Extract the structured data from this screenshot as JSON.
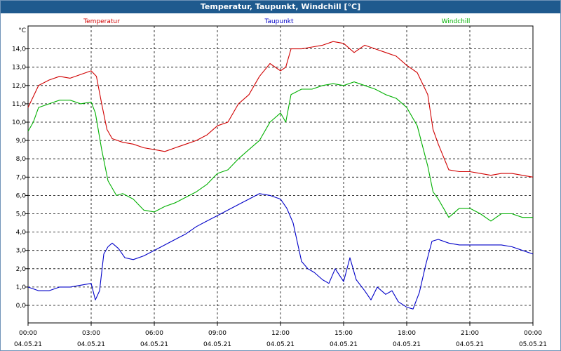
{
  "window": {
    "title": "Temperatur, Taupunkt, Windchill [°C]"
  },
  "chart_data": {
    "type": "line",
    "title": "Temperatur, Taupunkt, Windchill [°C]",
    "yunit": "°C",
    "ylim": [
      -1,
      15
    ],
    "xlim": [
      0,
      24
    ],
    "grid": true,
    "legend_position": "top",
    "y_ticks": [
      "0,0",
      "1,0",
      "2,0",
      "3,0",
      "4,0",
      "5,0",
      "6,0",
      "7,0",
      "8,0",
      "9,0",
      "10,0",
      "11,0",
      "12,0",
      "13,0",
      "14,0"
    ],
    "x_ticks": [
      {
        "time": "00:00",
        "date": "04.05.21"
      },
      {
        "time": "03:00",
        "date": "04.05.21"
      },
      {
        "time": "06:00",
        "date": "04.05.21"
      },
      {
        "time": "09:00",
        "date": "04.05.21"
      },
      {
        "time": "12:00",
        "date": "04.05.21"
      },
      {
        "time": "15:00",
        "date": "04.05.21"
      },
      {
        "time": "18:00",
        "date": "04.05.21"
      },
      {
        "time": "21:00",
        "date": "04.05.21"
      },
      {
        "time": "00:00",
        "date": "05.05.21"
      }
    ],
    "series": [
      {
        "name": "Temperatur",
        "color": "#d00000",
        "x": [
          0,
          0.25,
          0.5,
          1,
          1.5,
          2,
          2.5,
          3,
          3.25,
          3.5,
          3.75,
          4,
          4.5,
          5,
          5.5,
          6,
          6.5,
          7,
          7.5,
          8,
          8.5,
          9,
          9.5,
          10,
          10.5,
          11,
          11.5,
          12,
          12.25,
          12.5,
          13,
          13.5,
          14,
          14.5,
          15,
          15.5,
          16,
          16.5,
          17,
          17.5,
          18,
          18.5,
          19,
          19.25,
          19.5,
          20,
          20.5,
          21,
          21.5,
          22,
          22.5,
          23,
          23.5,
          24
        ],
        "values": [
          10.8,
          11.4,
          12.0,
          12.3,
          12.5,
          12.4,
          12.6,
          12.8,
          12.5,
          11.0,
          9.6,
          9.1,
          8.9,
          8.8,
          8.6,
          8.5,
          8.4,
          8.6,
          8.8,
          9.0,
          9.3,
          9.8,
          10.0,
          11.0,
          11.5,
          12.5,
          13.2,
          12.8,
          13.0,
          14.0,
          14.0,
          14.1,
          14.2,
          14.4,
          14.3,
          13.8,
          14.2,
          14.0,
          13.8,
          13.6,
          13.1,
          12.7,
          11.5,
          9.6,
          8.8,
          7.4,
          7.3,
          7.3,
          7.2,
          7.1,
          7.2,
          7.2,
          7.1,
          7.0
        ]
      },
      {
        "name": "Taupunkt",
        "color": "#0000c8",
        "x": [
          0,
          0.5,
          1,
          1.5,
          2,
          2.5,
          3,
          3.2,
          3.4,
          3.6,
          3.8,
          4,
          4.3,
          4.6,
          5,
          5.5,
          6,
          6.5,
          7,
          7.5,
          8,
          8.5,
          9,
          9.5,
          10,
          10.5,
          11,
          11.5,
          12,
          12.3,
          12.6,
          13,
          13.3,
          13.6,
          14,
          14.3,
          14.6,
          15,
          15.3,
          15.6,
          16,
          16.3,
          16.6,
          17,
          17.3,
          17.6,
          18,
          18.3,
          18.6,
          18.9,
          19.2,
          19.5,
          20,
          20.5,
          21,
          21.5,
          22,
          22.5,
          23,
          23.5,
          24
        ],
        "values": [
          1.0,
          0.8,
          0.8,
          1.0,
          1.0,
          1.1,
          1.2,
          0.3,
          0.8,
          2.8,
          3.2,
          3.4,
          3.1,
          2.6,
          2.5,
          2.7,
          3.0,
          3.3,
          3.6,
          3.9,
          4.3,
          4.6,
          4.9,
          5.2,
          5.5,
          5.8,
          6.1,
          6.0,
          5.8,
          5.3,
          4.5,
          2.4,
          2.0,
          1.8,
          1.4,
          1.2,
          2.0,
          1.3,
          2.6,
          1.4,
          0.8,
          0.3,
          1.0,
          0.6,
          0.8,
          0.2,
          -0.1,
          -0.2,
          0.7,
          2.2,
          3.5,
          3.6,
          3.4,
          3.3,
          3.3,
          3.3,
          3.3,
          3.3,
          3.2,
          3.0,
          2.8
        ]
      },
      {
        "name": "Windchill",
        "color": "#00b000",
        "x": [
          0,
          0.25,
          0.5,
          1,
          1.5,
          2,
          2.5,
          3,
          3.2,
          3.5,
          3.8,
          4.2,
          4.5,
          5,
          5.5,
          6,
          6.5,
          7,
          7.5,
          8,
          8.5,
          9,
          9.5,
          10,
          10.5,
          11,
          11.5,
          12,
          12.25,
          12.5,
          13,
          13.5,
          14,
          14.5,
          15,
          15.5,
          16,
          16.5,
          17,
          17.5,
          18,
          18.5,
          19,
          19.25,
          19.5,
          20,
          20.5,
          21,
          21.5,
          22,
          22.5,
          23,
          23.5,
          24
        ],
        "values": [
          9.5,
          10.0,
          10.8,
          11.0,
          11.2,
          11.2,
          11.0,
          11.1,
          10.5,
          8.5,
          6.8,
          6.0,
          6.1,
          5.8,
          5.2,
          5.1,
          5.4,
          5.6,
          5.9,
          6.2,
          6.6,
          7.2,
          7.4,
          8.0,
          8.5,
          9.0,
          10.0,
          10.5,
          10.0,
          11.5,
          11.8,
          11.8,
          12.0,
          12.1,
          12.0,
          12.2,
          12.0,
          11.8,
          11.5,
          11.3,
          10.8,
          9.8,
          7.6,
          6.2,
          5.8,
          4.8,
          5.3,
          5.3,
          5.0,
          4.6,
          5.0,
          5.0,
          4.8,
          4.8
        ]
      }
    ]
  }
}
